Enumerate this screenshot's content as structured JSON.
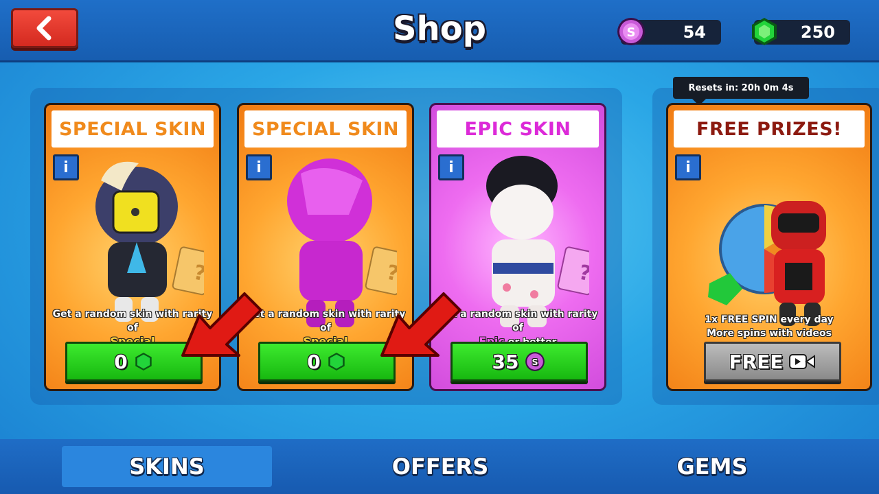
{
  "header": {
    "title": "Shop",
    "coins": "54",
    "gems": "250"
  },
  "cards": [
    {
      "title": "SPECIAL SKIN",
      "desc_line1": "Get a random skin with rarity of",
      "rarity": "Special",
      "rarity_suffix": "",
      "price": "0",
      "currency_icon": "gem-icon"
    },
    {
      "title": "SPECIAL SKIN",
      "desc_line1": "Get a random skin with rarity of",
      "rarity": "Special",
      "rarity_suffix": "",
      "price": "0",
      "currency_icon": "gem-icon"
    },
    {
      "title": "EPIC SKIN",
      "desc_line1": "Get a random skin with rarity of",
      "rarity": "Epic",
      "rarity_suffix": " or better",
      "price": "35",
      "currency_icon": "coin-icon"
    }
  ],
  "free_prizes": {
    "reset_label": "Resets in:",
    "reset_time": "20h 0m 4s",
    "title": "FREE PRIZES!",
    "line1": "1x FREE SPIN every day",
    "line2": "More spins with videos",
    "button": "FREE"
  },
  "tabs": [
    {
      "label": "SKINS",
      "active": true
    },
    {
      "label": "OFFERS",
      "active": false
    },
    {
      "label": "GEMS",
      "active": false
    }
  ],
  "colors": {
    "accent_green": "#2ad820",
    "orange_card": "#ffa630",
    "epic_pink": "#ee6cf0",
    "back_red": "#e83a2e"
  }
}
